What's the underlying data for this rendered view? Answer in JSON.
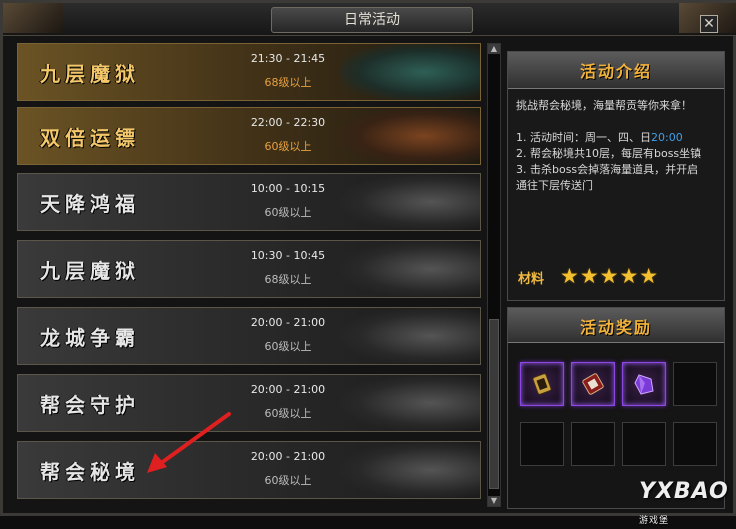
{
  "window": {
    "title": "日常活动",
    "close_label": "✕"
  },
  "activities": [
    {
      "name": "九层魔狱",
      "time": "21:30 - 21:45",
      "level": "68级以上",
      "style": "gold",
      "art": "teal"
    },
    {
      "name": "双倍运镖",
      "time": "22:00 - 22:30",
      "level": "60级以上",
      "style": "gold",
      "art": "bronze"
    },
    {
      "name": "天降鸿福",
      "time": "10:00 - 10:15",
      "level": "60级以上",
      "style": "grey",
      "art": "grey"
    },
    {
      "name": "九层魔狱",
      "time": "10:30 - 10:45",
      "level": "68级以上",
      "style": "grey",
      "art": "grey"
    },
    {
      "name": "龙城争霸",
      "time": "20:00 - 21:00",
      "level": "60级以上",
      "style": "grey",
      "art": "grey"
    },
    {
      "name": "帮会守护",
      "time": "20:00 - 21:00",
      "level": "60级以上",
      "style": "grey",
      "art": "grey"
    },
    {
      "name": "帮会秘境",
      "time": "20:00 - 21:00",
      "level": "60级以上",
      "style": "grey",
      "art": "grey"
    }
  ],
  "intro": {
    "title": "活动介绍",
    "lines": {
      "l1": "挑战帮会秘境，海量帮贡等你来拿！",
      "l2a": "1. 活动时间：周一、四、日",
      "l2b": "20:00",
      "l3": "2. 帮会秘境共10层，每层有boss坐镇",
      "l4": "3. 击杀boss会掉落海量道具，并开启",
      "l5": "通往下层传送门"
    },
    "material_label": "材料",
    "stars": "★★★★★",
    "stars_count": 5
  },
  "rewards": {
    "title": "活动奖励",
    "slots": [
      {
        "icon": "badge-token-icon",
        "filled": true
      },
      {
        "icon": "red-scroll-icon",
        "filled": true
      },
      {
        "icon": "purple-crystal-icon",
        "filled": true
      },
      {
        "icon": "",
        "filled": false
      },
      {
        "icon": "",
        "filled": false
      },
      {
        "icon": "",
        "filled": false
      },
      {
        "icon": "",
        "filled": false
      },
      {
        "icon": "",
        "filled": false
      }
    ]
  },
  "scroll": {
    "up": "▲",
    "down": "▼"
  },
  "watermark": {
    "brand": "YXBAO",
    "sub": "游戏堡"
  },
  "colors": {
    "accent_gold": "#f2b23a",
    "highlight_blue": "#3fa0e8",
    "rare_purple": "#8a48e0"
  }
}
